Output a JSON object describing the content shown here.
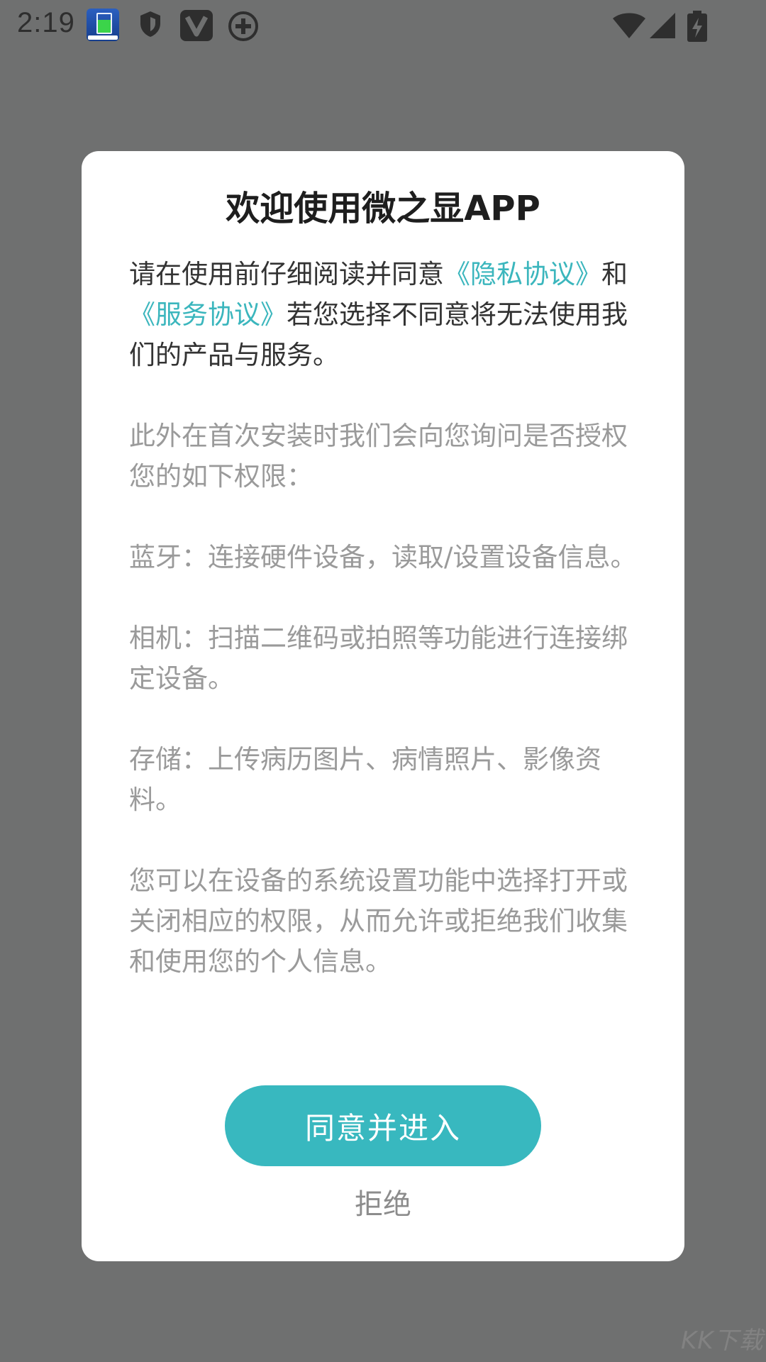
{
  "status_bar": {
    "time": "2:19"
  },
  "dialog": {
    "title": "欢迎使用微之显APP",
    "intro": {
      "before_link1": "请在使用前仔细阅读并同意",
      "link1": "《隐私协议》",
      "between": "和",
      "link2": "《服务协议》",
      "after_link2": "若您选择不同意将无法使用我们的产品与服务。"
    },
    "permissions_intro": "此外在首次安装时我们会向您询问是否授权您的如下权限：",
    "permissions": [
      "蓝牙：连接硬件设备，读取/设置设备信息。",
      "相机：扫描二维码或拍照等功能进行连接绑定设备。",
      "存储：上传病历图片、病情照片、影像资料。"
    ],
    "footer_note": "您可以在设备的系统设置功能中选择打开或关闭相应的权限，从而允许或拒绝我们收集和使用您的个人信息。",
    "agree_label": "同意并进入",
    "reject_label": "拒绝"
  },
  "watermark": "KK下载",
  "colors": {
    "accent": "#38b8bf",
    "link": "#3bb6bd",
    "overlay": "#6f7070",
    "muted_text": "#9a9a9a"
  }
}
